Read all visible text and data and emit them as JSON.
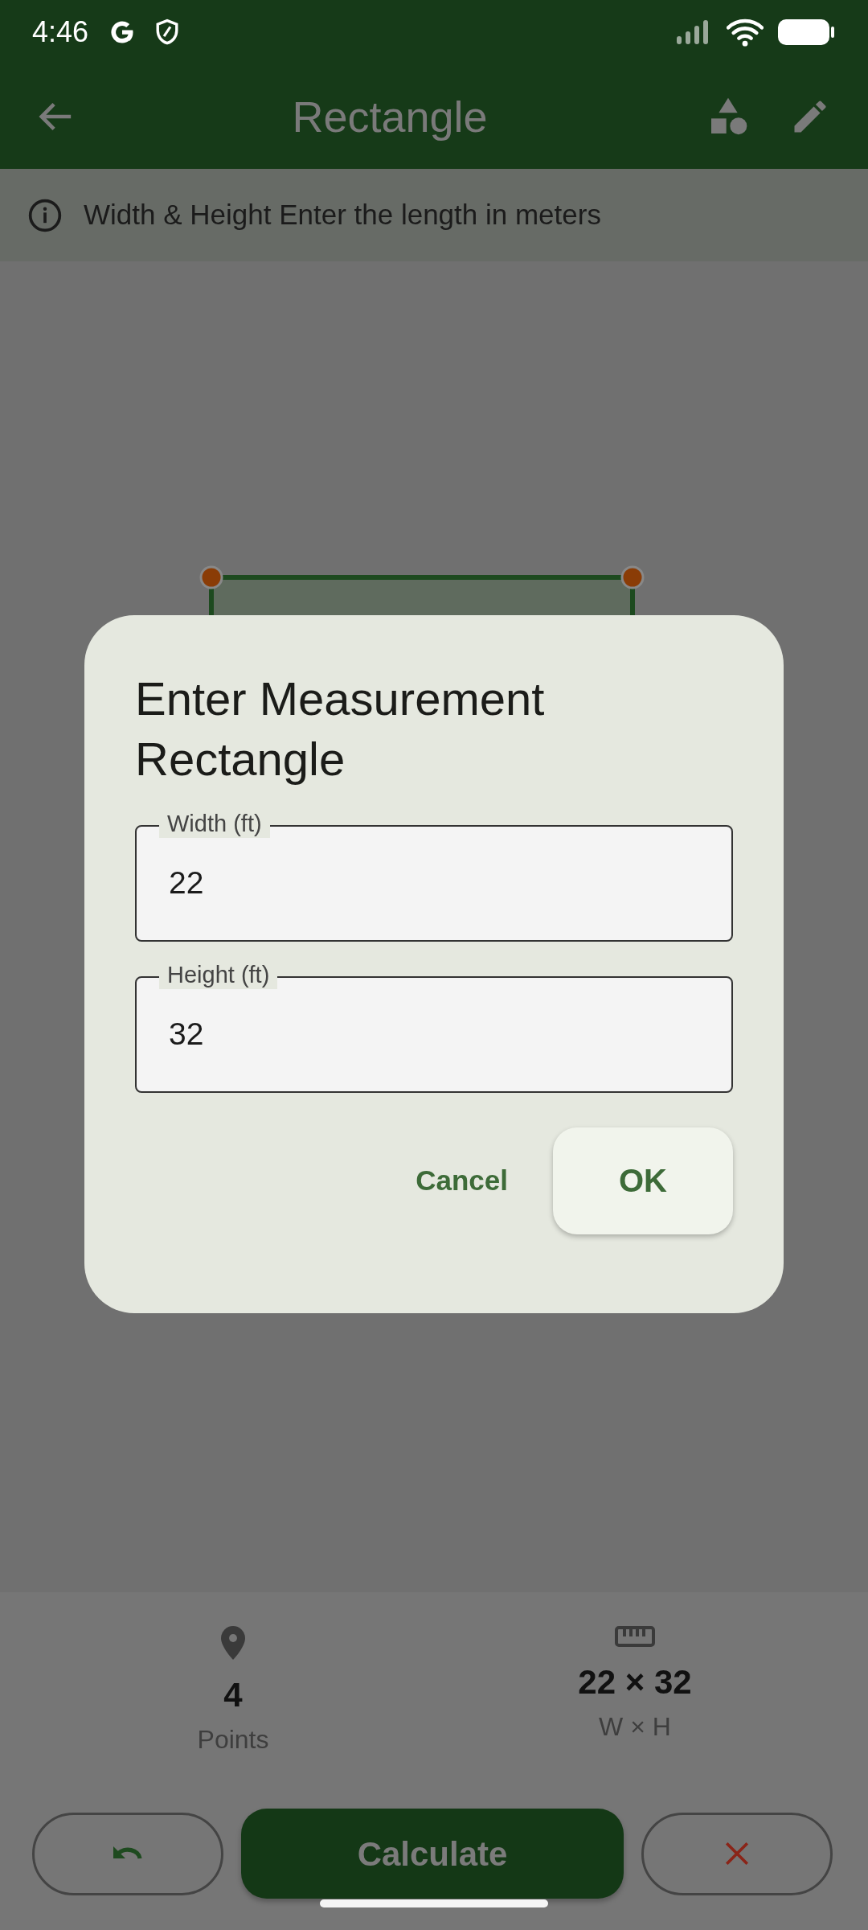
{
  "status_bar": {
    "time": "4:46"
  },
  "app_bar": {
    "title": "Rectangle"
  },
  "info_banner": {
    "text": "Width & Height Enter the length in meters"
  },
  "dialog": {
    "title": "Enter Measurement Rectangle",
    "fields": [
      {
        "label": "Width (ft)",
        "value": "22"
      },
      {
        "label": "Height (ft)",
        "value": "32"
      }
    ],
    "buttons": [
      {
        "kind": "text",
        "label": "Cancel"
      },
      {
        "kind": "tonal",
        "label": "OK"
      }
    ]
  },
  "stats": [
    {
      "kind": "points",
      "value": "4",
      "label": "Points"
    },
    {
      "kind": "size",
      "value": "22 × 32",
      "label": "W × H"
    }
  ],
  "actions": [
    {
      "kind": "undo"
    },
    {
      "kind": "primary",
      "label": "Calculate"
    },
    {
      "kind": "clear"
    }
  ]
}
